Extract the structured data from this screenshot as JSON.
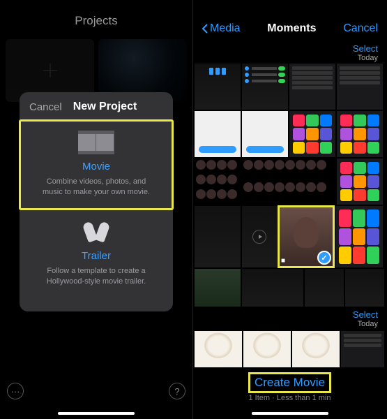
{
  "left": {
    "header": "Projects",
    "sheet": {
      "cancel": "Cancel",
      "title": "New Project",
      "movie": {
        "title": "Movie",
        "desc": "Combine videos, photos, and music to make your own movie."
      },
      "trailer": {
        "title": "Trailer",
        "desc": "Follow a template to create a Hollywood-style movie trailer."
      }
    },
    "more_icon": "···",
    "help_icon": "?"
  },
  "right": {
    "nav": {
      "back": "Media",
      "title": "Moments",
      "cancel": "Cancel"
    },
    "section1": {
      "select": "Select",
      "day": "Today"
    },
    "section2": {
      "select": "Select",
      "day": "Today"
    },
    "create": {
      "label": "Create Movie",
      "sub": "1 Item · Less than 1 min"
    },
    "app_colors": [
      "#ff2d55",
      "#34c759",
      "#007aff",
      "#af52de",
      "#ff9500",
      "#5856d6",
      "#ffcc00",
      "#ff3b30",
      "#30d158"
    ]
  }
}
